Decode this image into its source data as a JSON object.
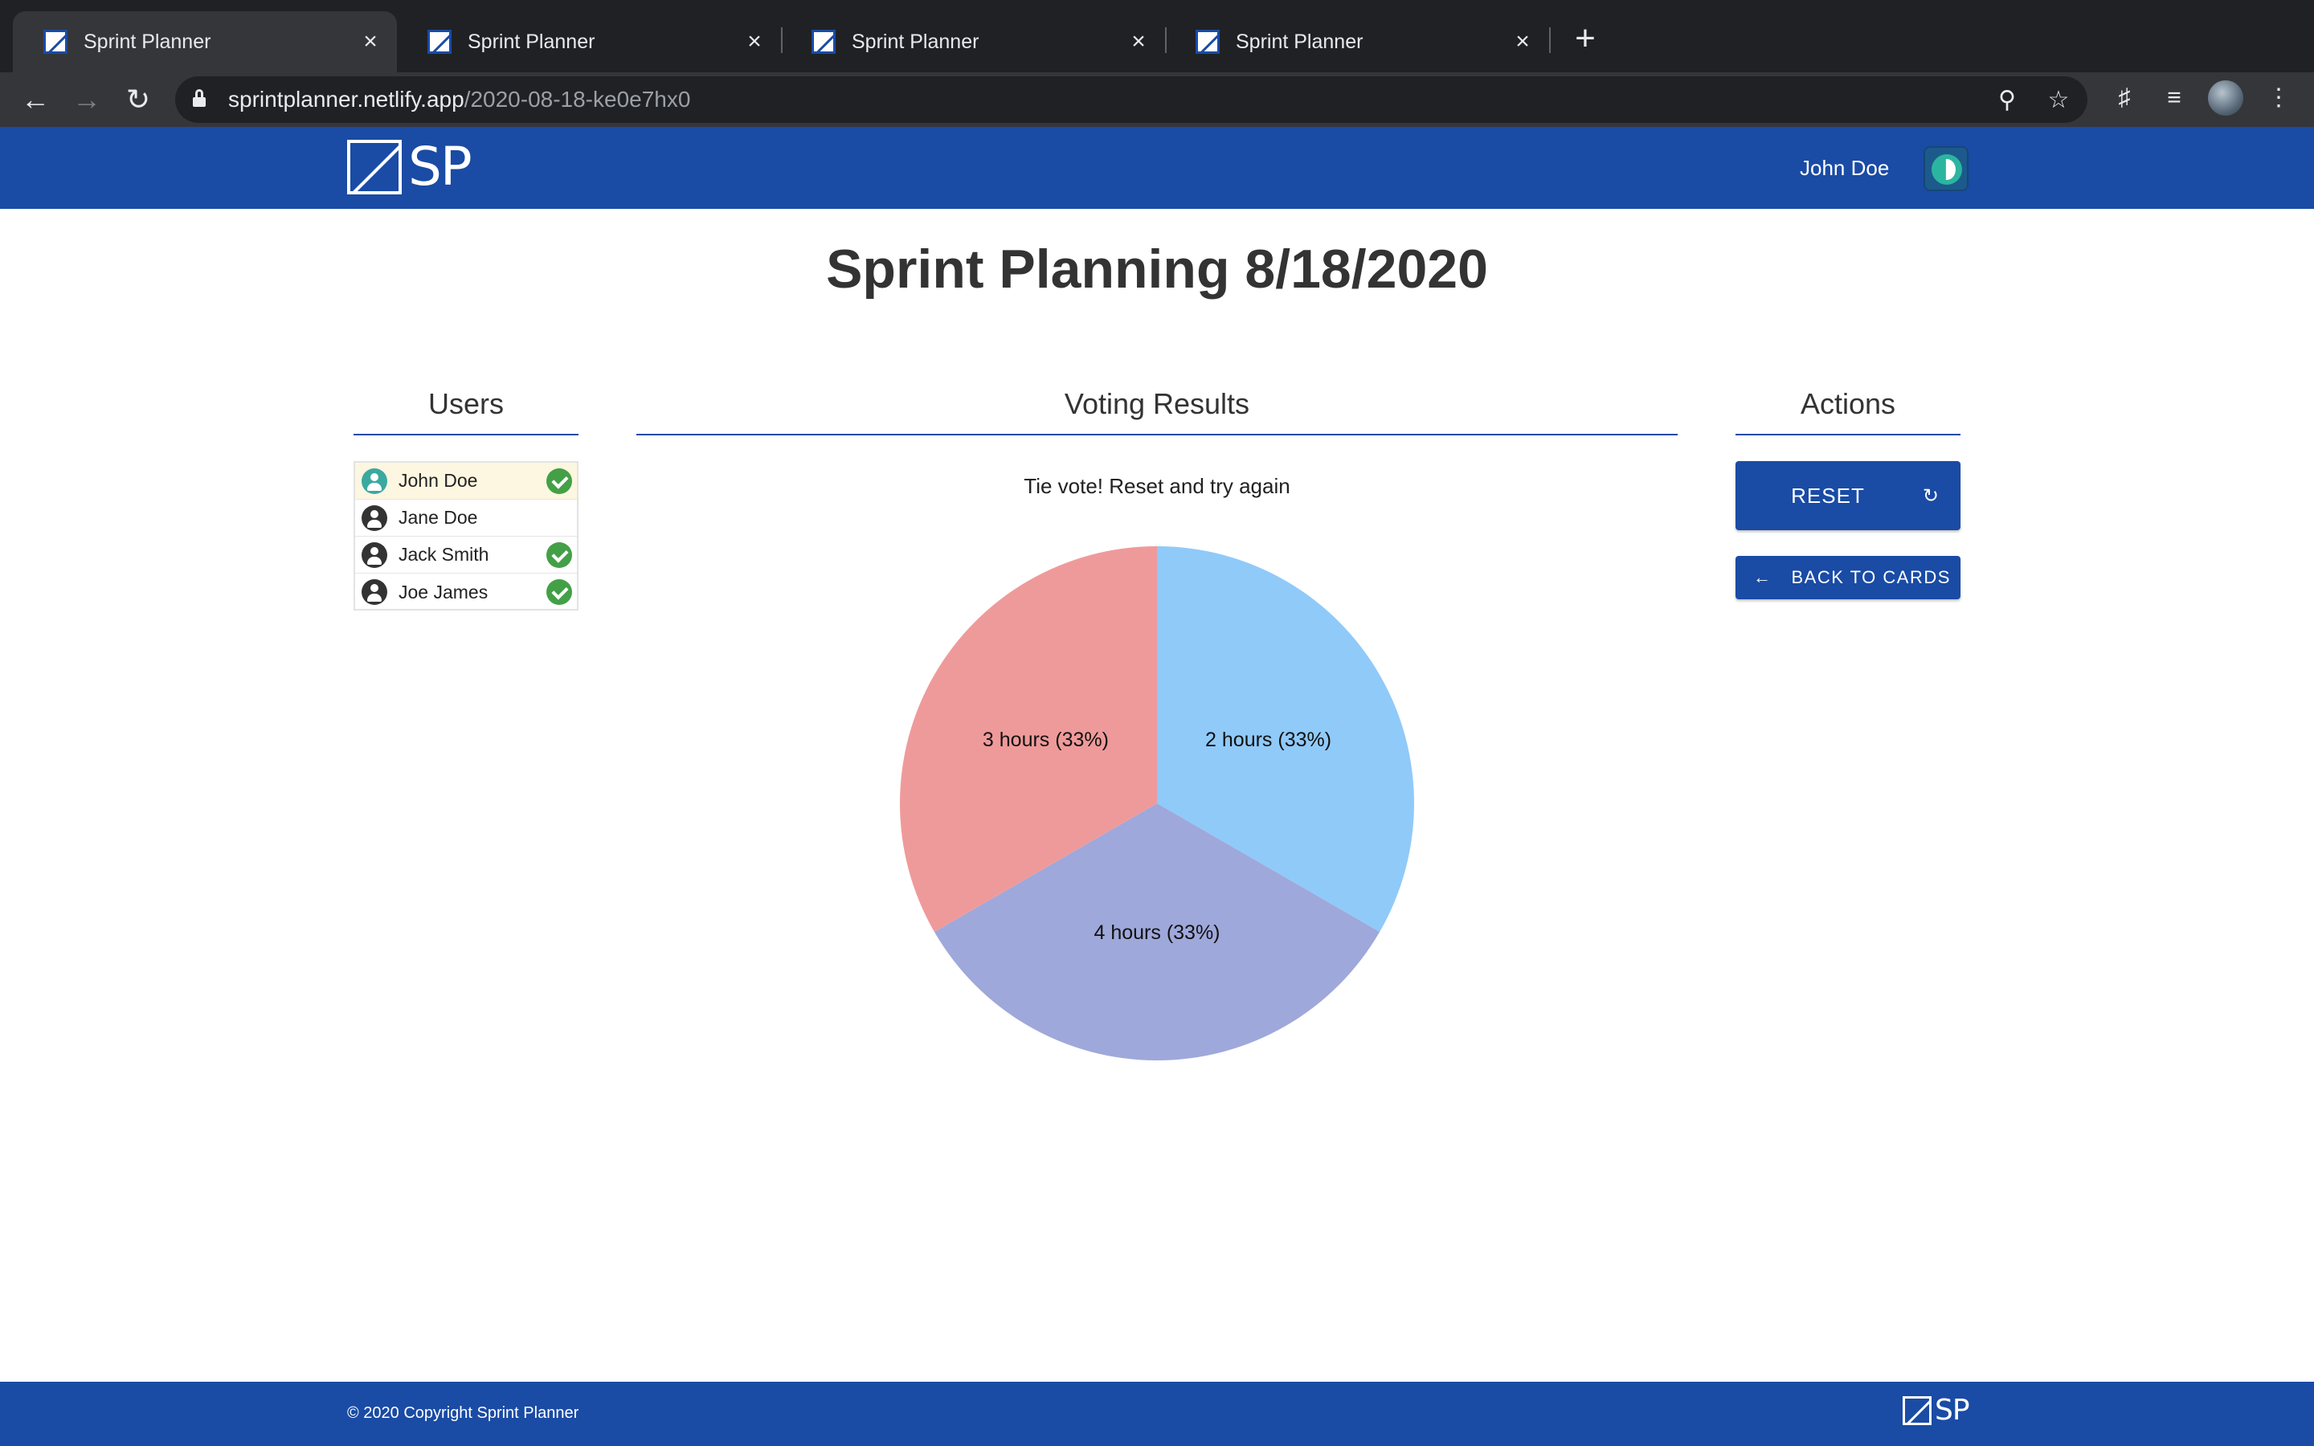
{
  "browser": {
    "tabs": [
      {
        "title": "Sprint Planner",
        "active": true
      },
      {
        "title": "Sprint Planner",
        "active": false
      },
      {
        "title": "Sprint Planner",
        "active": false
      },
      {
        "title": "Sprint Planner",
        "active": false
      }
    ],
    "url_host": "sprintplanner.netlify.app",
    "url_path": "/2020-08-18-ke0e7hx0"
  },
  "header": {
    "logo_text": "SP",
    "user_name": "John Doe"
  },
  "page": {
    "title": "Sprint Planning 8/18/2020"
  },
  "users": {
    "title": "Users",
    "items": [
      {
        "name": "John Doe",
        "voted": true,
        "current": true
      },
      {
        "name": "Jane Doe",
        "voted": false,
        "current": false
      },
      {
        "name": "Jack Smith",
        "voted": true,
        "current": false
      },
      {
        "name": "Joe James",
        "voted": true,
        "current": false
      }
    ]
  },
  "results": {
    "title": "Voting Results",
    "message": "Tie vote! Reset and try again"
  },
  "actions": {
    "title": "Actions",
    "reset_label": "RESET",
    "back_label": "BACK TO CARDS"
  },
  "chart_data": {
    "type": "pie",
    "categories": [
      "2 hours",
      "4 hours",
      "3 hours"
    ],
    "values": [
      1,
      1,
      1
    ],
    "labels": [
      "2 hours (33%)",
      "4 hours (33%)",
      "3 hours (33%)"
    ],
    "colors": [
      "#90caf9",
      "#9fa8da",
      "#ef9a9a"
    ]
  },
  "footer": {
    "copyright": "© 2020 Copyright Sprint Planner",
    "logo_text": "SP"
  },
  "colors": {
    "primary": "#1a4ba5",
    "check": "#43a047"
  }
}
